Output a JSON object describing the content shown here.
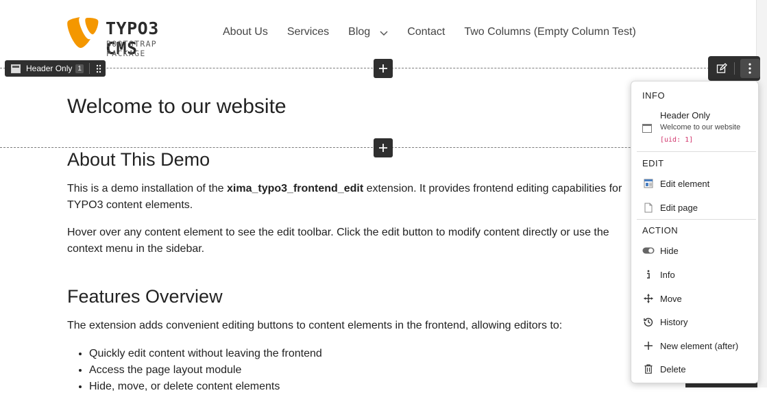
{
  "header": {
    "logo_title": "TYPO3 CMS",
    "logo_subtitle": "BOOTSTRAP PACKAGE",
    "logo_color": "#f49700",
    "nav": [
      {
        "label": "About Us"
      },
      {
        "label": "Services"
      },
      {
        "label": "Blog",
        "has_dropdown": true
      },
      {
        "label": "Contact"
      },
      {
        "label": "Two Columns (Empty Column Test)"
      }
    ]
  },
  "edit_toolbar": {
    "element_type": "Header Only",
    "uid_badge": "1",
    "add_label": "+",
    "edit_icon": "pencil-edit-icon",
    "more_icon": "vertical-dots-icon"
  },
  "content": {
    "title": "Welcome to our website",
    "section1_heading": "About This Demo",
    "para1_before": "This is a demo installation of the ",
    "para1_bold": "xima_typo3_frontend_edit",
    "para1_after": " extension. It provides frontend editing capabilities for TYPO3 content elements.",
    "para2": "Hover over any content element to see the edit toolbar. Click the edit button to modify content directly or use the context menu in the sidebar.",
    "section2_heading": "Features Overview",
    "para3": "The extension adds convenient editing buttons to content elements in the frontend, allowing editors to:",
    "features": [
      "Quickly edit content without leaving the frontend",
      "Access the page layout module",
      "Hide, move, or delete content elements"
    ]
  },
  "menu": {
    "info_header": "INFO",
    "info_title": "Header Only",
    "info_subtitle": "Welcome to our website",
    "info_uid": "[uid: 1]",
    "edit_header": "EDIT",
    "edit_items": [
      {
        "label": "Edit element",
        "icon": "content-element-icon"
      },
      {
        "label": "Edit page",
        "icon": "page-icon"
      }
    ],
    "action_header": "ACTION",
    "action_items": [
      {
        "label": "Hide",
        "icon": "toggle-icon"
      },
      {
        "label": "Info",
        "icon": "info-icon"
      },
      {
        "label": "Move",
        "icon": "move-arrows-icon"
      },
      {
        "label": "History",
        "icon": "history-icon"
      },
      {
        "label": "New element (after)",
        "icon": "plus-icon"
      },
      {
        "label": "Delete",
        "icon": "trash-icon"
      }
    ]
  }
}
